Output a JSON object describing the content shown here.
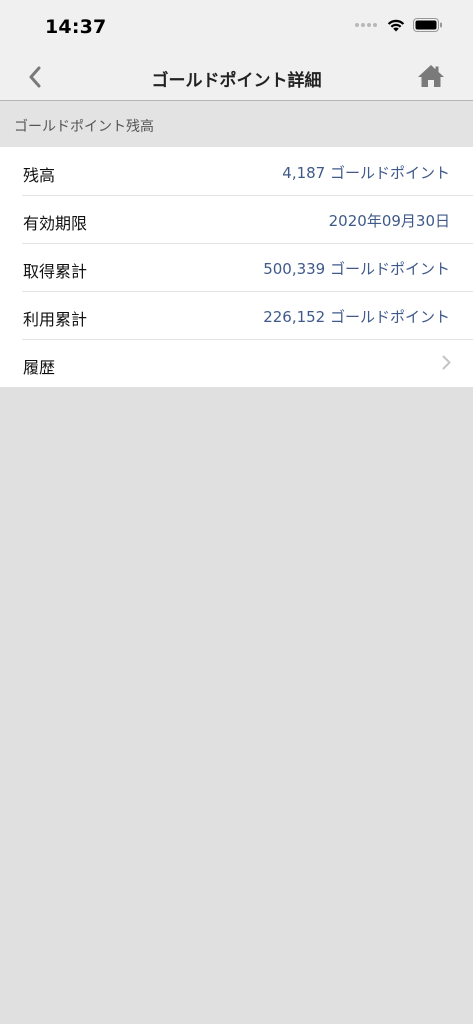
{
  "status_bar": {
    "time": "14:37",
    "icons": [
      "cellular-signal-icon",
      "wifi-icon",
      "battery-icon"
    ]
  },
  "nav": {
    "title": "ゴールドポイント詳細",
    "back_icon": "chevron-left-icon",
    "home_icon": "home-icon"
  },
  "section": {
    "header": "ゴールドポイント残高"
  },
  "rows": [
    {
      "label": "残高",
      "value": "4,187 ゴールドポイント"
    },
    {
      "label": "有効期限",
      "value": "2020年09月30日"
    },
    {
      "label": "取得累計",
      "value": "500,339 ゴールドポイント"
    },
    {
      "label": "利用累計",
      "value": "226,152 ゴールドポイント"
    },
    {
      "label": "履歴",
      "value": "",
      "icon": "chevron-right-icon"
    }
  ],
  "colors": {
    "value_text": "#3f5a8a",
    "nav_icon": "#7a7a7a",
    "background": "#e0e0e0"
  }
}
